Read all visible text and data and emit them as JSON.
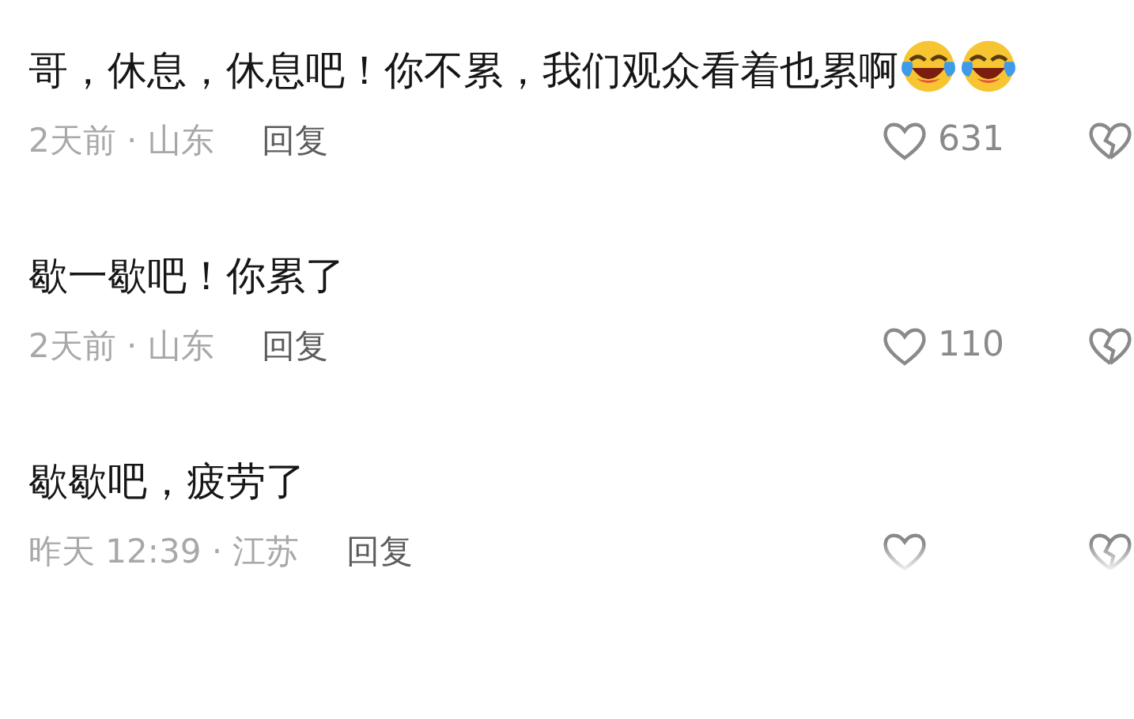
{
  "comments": [
    {
      "text": "哥，休息，休息吧！你不累，我们观众看着也累啊",
      "emojis": [
        {
          "kind": "laugh-cry"
        },
        {
          "kind": "laugh-cry"
        }
      ],
      "time_location": "2天前 · 山东",
      "reply": "回复",
      "likes": "631",
      "faded": false
    },
    {
      "text": "歇一歇吧！你累了",
      "time_location": "2天前 · 山东",
      "reply": "回复",
      "likes": "110",
      "faded": false
    },
    {
      "text": "歇歇吧，疲劳了",
      "time_location": "昨天 12:39 · 江苏",
      "reply": "回复",
      "faded": true
    }
  ]
}
